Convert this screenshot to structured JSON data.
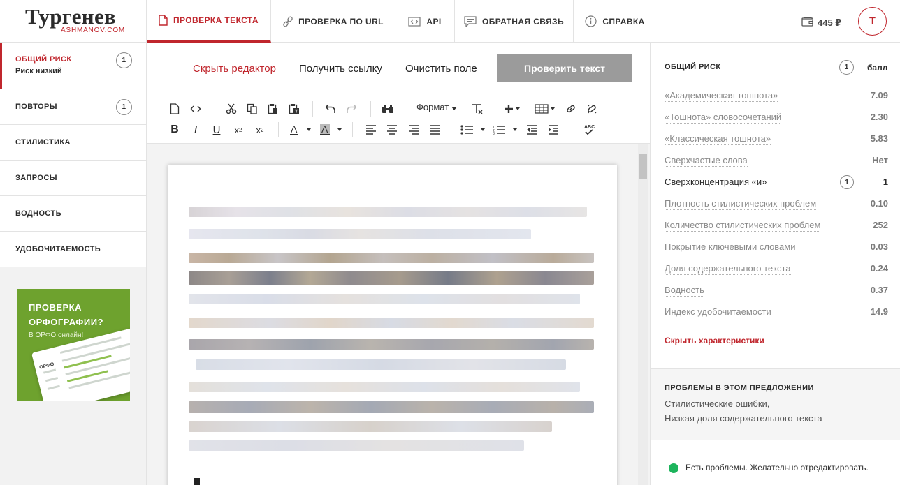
{
  "header": {
    "logo_title": "Тургенев",
    "logo_sub": "ASHMANOV.COM",
    "tabs": [
      {
        "label": "ПРОВЕРКА ТЕКСТА",
        "icon": "document-icon"
      },
      {
        "label": "ПРОВЕРКА ПО URL",
        "icon": "link-icon"
      },
      {
        "label": "API",
        "icon": "code-icon"
      },
      {
        "label": "ОБРАТНАЯ СВЯЗЬ",
        "icon": "chat-icon"
      },
      {
        "label": "СПРАВКА",
        "icon": "info-icon"
      }
    ],
    "balance": "445 ₽",
    "avatar_letter": "Т"
  },
  "sidebar": {
    "items": [
      {
        "label": "ОБЩИЙ РИСК",
        "sublabel": "Риск низкий",
        "count": "1"
      },
      {
        "label": "ПОВТОРЫ",
        "count": "1"
      },
      {
        "label": "СТИЛИСТИКА"
      },
      {
        "label": "ЗАПРОСЫ"
      },
      {
        "label": "ВОДНОСТЬ"
      },
      {
        "label": "УДОБОЧИТАЕМОСТЬ"
      }
    ],
    "promo": {
      "title_line1": "ПРОВЕРКА",
      "title_line2": "ОРФОГРАФИИ?",
      "subtitle": "В ОРФО онлайн!",
      "card_logo": "ОРФО",
      "color": "#6ea22e"
    }
  },
  "editor": {
    "actions": {
      "hide_editor": "Скрыть редактор",
      "get_link": "Получить ссылку",
      "clear_field": "Очистить поле",
      "check_text": "Проверить текст"
    },
    "format_label": "Формат"
  },
  "stats": {
    "title": "ОБЩИЙ РИСК",
    "count": "1",
    "unit": "балл",
    "metrics": [
      {
        "name": "«Академическая тошнота»",
        "value": "7.09"
      },
      {
        "name": "«Тошнота» словосочетаний",
        "value": "2.30"
      },
      {
        "name": "«Классическая тошнота»",
        "value": "5.83"
      },
      {
        "name": "Сверхчастые слова",
        "value": "Нет"
      },
      {
        "name": "Сверхконцентрация «и»",
        "value": "1",
        "count": "1"
      },
      {
        "name": "Плотность стилистических проблем",
        "value": "0.10"
      },
      {
        "name": "Количество стилистических проблем",
        "value": "252"
      },
      {
        "name": "Покрытие ключевыми словами",
        "value": "0.03"
      },
      {
        "name": "Доля содержательного текста",
        "value": "0.24"
      },
      {
        "name": "Водность",
        "value": "0.37"
      },
      {
        "name": "Индекс удобочитаемости",
        "value": "14.9"
      }
    ],
    "hide_link": "Скрыть характеристики"
  },
  "problems": {
    "title": "ПРОБЛЕМЫ В ЭТОМ ПРЕДЛОЖЕНИИ",
    "line1": "Стилистические ошибки,",
    "line2": "Низкая доля содержательного текста"
  },
  "status": {
    "text": "Есть проблемы. Желательно отредактировать.",
    "color": "#1db45c"
  },
  "colors": {
    "accent": "#c0262d",
    "button_disabled": "#9b9b9b"
  }
}
